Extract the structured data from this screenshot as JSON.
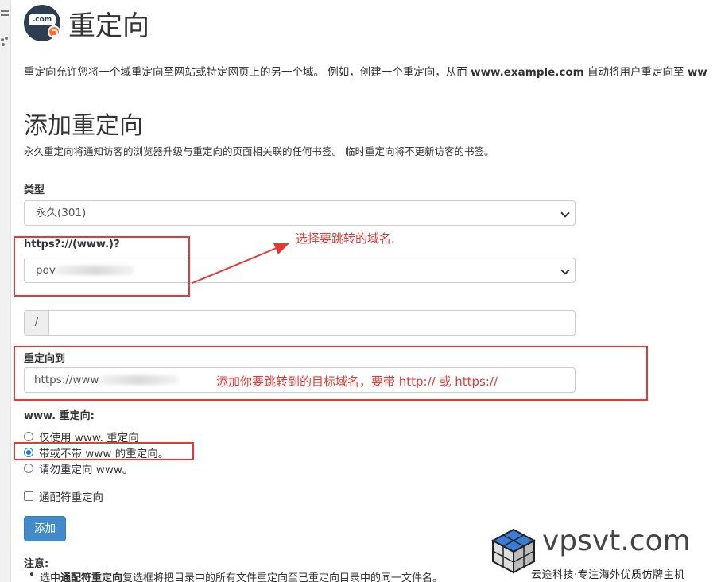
{
  "header": {
    "logo_text": ".com",
    "title": "重定向"
  },
  "intro": {
    "text_before": "重定向允许您将一个域重定向至网站或特定网页上的另一个域。 例如，创建一个重定向，从而 ",
    "example_domain": "www.example.com",
    "text_after": " 自动将用户重定向至 ",
    "trailing_bold": "ww"
  },
  "add_section": {
    "title": "添加重定向",
    "description": "永久重定向将通知访客的浏览器升级与重定向的页面相关联的任何书签。 临时重定向将不更新访客的书签。"
  },
  "form": {
    "type_label": "类型",
    "type_value": "永久(301)",
    "domain_label": "https?://(www.)?",
    "domain_value_visible": "pov",
    "path_prefix": "/",
    "path_value": "",
    "redirect_to_label": "重定向到",
    "redirect_to_value_visible": "https://www",
    "www_label": "www. 重定向:",
    "www_options": [
      {
        "label": "仅使用 www. 重定向",
        "checked": false
      },
      {
        "label": "带或不带 www 的重定向。",
        "checked": true
      },
      {
        "label": "请勿重定向 www。",
        "checked": false
      }
    ],
    "wildcard_label": "通配符重定向",
    "wildcard_checked": false,
    "submit_label": "添加"
  },
  "notes": {
    "label": "注意:",
    "item_prefix": "选中",
    "item_bold": "通配符重定向",
    "item_suffix": "复选框将把目录中的所有文件重定向至已重定向目录中的同一文件名。"
  },
  "annotations": {
    "choose_domain": "选择要跳转的域名.",
    "target_domain": "添加你要跳转到的目标域名，要带 http:// 或 https://"
  },
  "watermark": {
    "site": "vpsvt.com",
    "tagline": "云途科技·专注海外优质仿牌主机"
  },
  "colors": {
    "primary_button": "#428bca",
    "annotation_red": "#e53935",
    "logo_dark": "#2c3e50",
    "logo_accent": "#ff6c2c"
  }
}
